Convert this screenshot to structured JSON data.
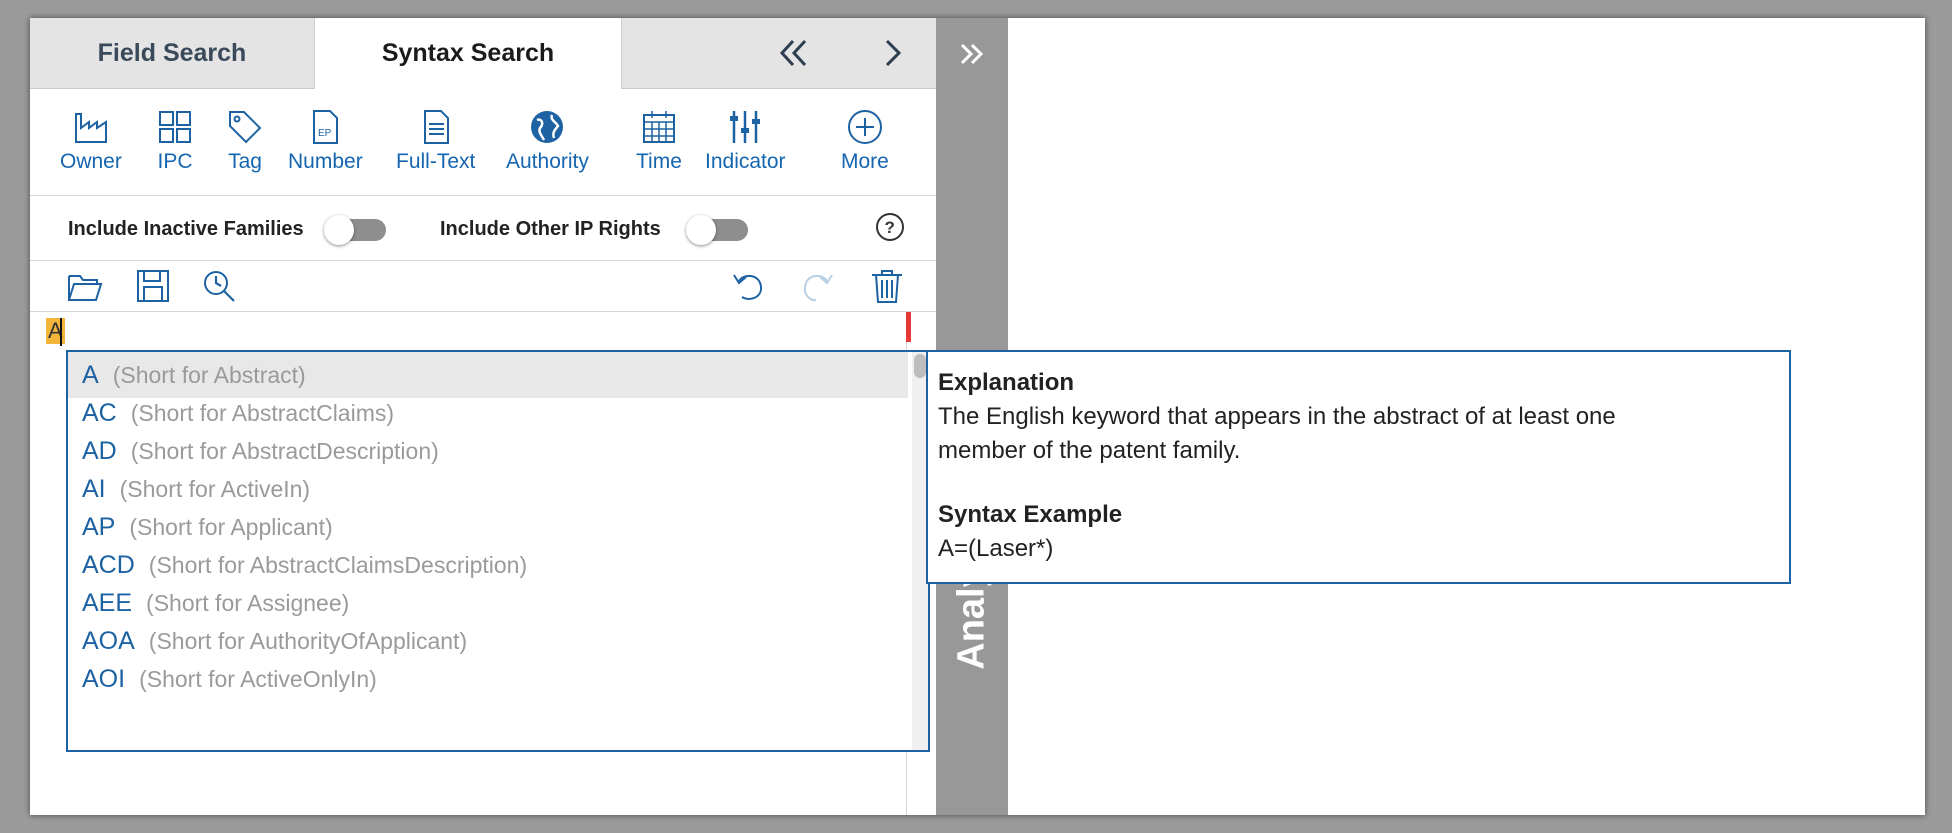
{
  "tabs": {
    "field_search": "Field Search",
    "syntax_search": "Syntax Search"
  },
  "toolbar": {
    "items": [
      {
        "label": "Owner",
        "icon": "factory-icon"
      },
      {
        "label": "IPC",
        "icon": "grid-icon"
      },
      {
        "label": "Tag",
        "icon": "tag-icon"
      },
      {
        "label": "Number",
        "icon": "ep-document-icon"
      },
      {
        "label": "Full-Text",
        "icon": "document-icon"
      },
      {
        "label": "Authority",
        "icon": "globe-icon"
      },
      {
        "label": "Time",
        "icon": "calendar-icon"
      },
      {
        "label": "Indicator",
        "icon": "sliders-icon"
      },
      {
        "label": "More",
        "icon": "plus-circle-icon"
      }
    ]
  },
  "toggles": {
    "inactive_families": "Include Inactive Families",
    "other_ip_rights": "Include Other IP Rights"
  },
  "editor": {
    "typed_text": "A"
  },
  "autocomplete": {
    "items": [
      {
        "code": "A",
        "short": "(Short for Abstract)"
      },
      {
        "code": "AC",
        "short": "(Short for AbstractClaims)"
      },
      {
        "code": "AD",
        "short": "(Short for AbstractDescription)"
      },
      {
        "code": "AI",
        "short": "(Short for ActiveIn)"
      },
      {
        "code": "AP",
        "short": "(Short for Applicant)"
      },
      {
        "code": "ACD",
        "short": "(Short for AbstractClaimsDescription)"
      },
      {
        "code": "AEE",
        "short": "(Short for Assignee)"
      },
      {
        "code": "AOA",
        "short": "(Short for AuthorityOfApplicant)"
      },
      {
        "code": "AOI",
        "short": "(Short for ActiveOnlyIn)"
      }
    ]
  },
  "side_strip": {
    "label": "Analy"
  },
  "explanation": {
    "heading": "Explanation",
    "text_line1": "The English keyword that appears in the abstract of at least one",
    "text_line2": "member of the patent family.",
    "example_heading": "Syntax Example",
    "example": "A=(Laser*)"
  },
  "colors": {
    "accent": "#1d62a3",
    "highlight": "#f2b53a"
  }
}
